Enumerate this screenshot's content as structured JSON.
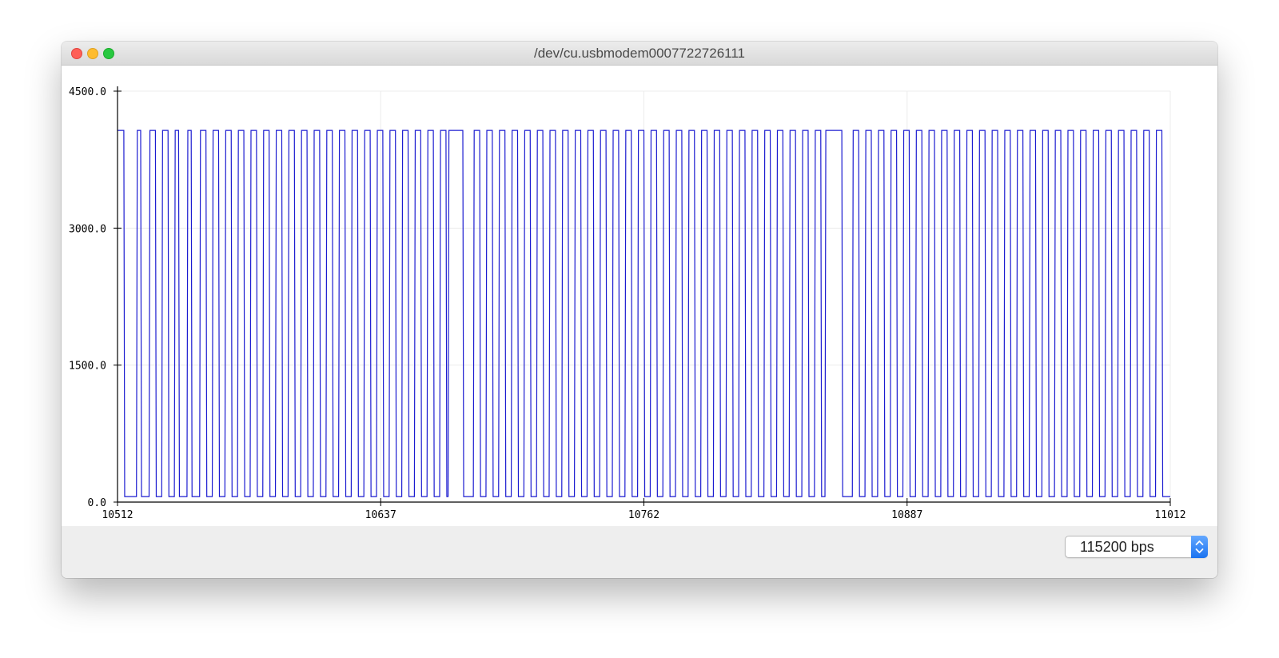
{
  "window": {
    "title": "/dev/cu.usbmodem0007722726111"
  },
  "footer": {
    "baud_rate": "115200 bps"
  },
  "colors": {
    "series": "#1b1bd0",
    "grid": "#ececec",
    "axis": "#000000"
  },
  "icons": {
    "close": "close-icon",
    "minimize": "minimize-icon",
    "zoom": "zoom-icon",
    "select_arrows": "chevron-updown-icon"
  },
  "chart_data": {
    "type": "line",
    "title": "",
    "xlabel": "",
    "ylabel": "",
    "xlim": [
      10512,
      11012
    ],
    "ylim": [
      0,
      4500
    ],
    "x_ticks": [
      "10512",
      "10637",
      "10762",
      "10887",
      "11012"
    ],
    "y_ticks": [
      "0.0",
      "1500.0",
      "3000.0",
      "4500.0"
    ],
    "grid": true,
    "legend": "none",
    "series": [
      {
        "high": 4070,
        "low": 60,
        "high_intervals": [
          [
            10512,
            10515
          ],
          [
            10521,
            10523
          ],
          [
            10527,
            10530
          ],
          [
            10533,
            10536
          ],
          [
            10539,
            10541
          ],
          [
            10545,
            10547
          ],
          [
            10551,
            10554
          ],
          [
            10557,
            10560
          ],
          [
            10563,
            10566
          ],
          [
            10569,
            10572
          ],
          [
            10575,
            10578
          ],
          [
            10581,
            10584
          ],
          [
            10587,
            10590
          ],
          [
            10593,
            10596
          ],
          [
            10599,
            10602
          ],
          [
            10605,
            10608
          ],
          [
            10611,
            10614
          ],
          [
            10617,
            10620
          ],
          [
            10623,
            10626
          ],
          [
            10629,
            10632
          ],
          [
            10635,
            10638
          ],
          [
            10641,
            10644
          ],
          [
            10647,
            10650
          ],
          [
            10653,
            10656
          ],
          [
            10659,
            10662
          ],
          [
            10665,
            10668
          ],
          [
            10669,
            10676
          ],
          [
            10681,
            10684
          ],
          [
            10687,
            10690
          ],
          [
            10693,
            10696
          ],
          [
            10699,
            10702
          ],
          [
            10705,
            10708
          ],
          [
            10711,
            10714
          ],
          [
            10717,
            10720
          ],
          [
            10723,
            10726
          ],
          [
            10729,
            10732
          ],
          [
            10735,
            10738
          ],
          [
            10741,
            10744
          ],
          [
            10747,
            10750
          ],
          [
            10753,
            10756
          ],
          [
            10759,
            10762
          ],
          [
            10765,
            10768
          ],
          [
            10771,
            10774
          ],
          [
            10777,
            10780
          ],
          [
            10783,
            10786
          ],
          [
            10789,
            10792
          ],
          [
            10795,
            10798
          ],
          [
            10801,
            10804
          ],
          [
            10807,
            10810
          ],
          [
            10813,
            10816
          ],
          [
            10819,
            10822
          ],
          [
            10825,
            10828
          ],
          [
            10831,
            10834
          ],
          [
            10837,
            10840
          ],
          [
            10843,
            10846
          ],
          [
            10848,
            10856
          ],
          [
            10861,
            10864
          ],
          [
            10867,
            10870
          ],
          [
            10873,
            10876
          ],
          [
            10879,
            10882
          ],
          [
            10885,
            10888
          ],
          [
            10891,
            10894
          ],
          [
            10897,
            10900
          ],
          [
            10903,
            10906
          ],
          [
            10909,
            10912
          ],
          [
            10915,
            10918
          ],
          [
            10921,
            10924
          ],
          [
            10927,
            10930
          ],
          [
            10933,
            10936
          ],
          [
            10939,
            10942
          ],
          [
            10945,
            10948
          ],
          [
            10951,
            10954
          ],
          [
            10957,
            10960
          ],
          [
            10963,
            10966
          ],
          [
            10969,
            10972
          ],
          [
            10975,
            10978
          ],
          [
            10981,
            10984
          ],
          [
            10987,
            10990
          ],
          [
            10993,
            10996
          ],
          [
            10999,
            11002
          ],
          [
            11005,
            11008
          ]
        ]
      }
    ]
  }
}
